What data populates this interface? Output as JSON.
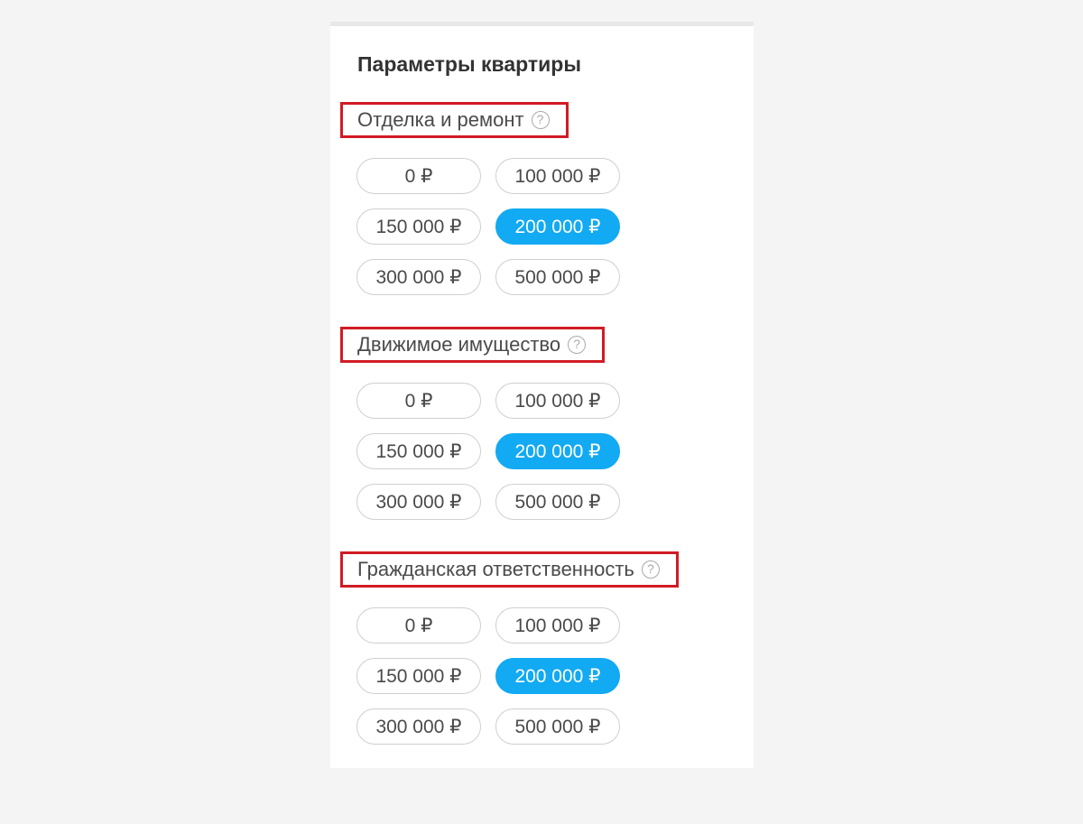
{
  "panel": {
    "title": "Параметры квартиры"
  },
  "sections": [
    {
      "label": "Отделка и ремонт",
      "help_glyph": "?",
      "options": [
        "0 ₽",
        "100 000 ₽",
        "150 000 ₽",
        "200 000 ₽",
        "300 000 ₽",
        "500 000 ₽"
      ],
      "selected_value": "200 000 ₽"
    },
    {
      "label": "Движимое имущество",
      "help_glyph": "?",
      "options": [
        "0 ₽",
        "100 000 ₽",
        "150 000 ₽",
        "200 000 ₽",
        "300 000 ₽",
        "500 000 ₽"
      ],
      "selected_value": "200 000 ₽"
    },
    {
      "label": "Гражданская ответственность",
      "help_glyph": "?",
      "options": [
        "0 ₽",
        "100 000 ₽",
        "150 000 ₽",
        "200 000 ₽",
        "300 000 ₽",
        "500 000 ₽"
      ],
      "selected_value": "200 000 ₽"
    }
  ],
  "colors": {
    "selected_bg": "#12aaf2",
    "highlight_border": "#d11b24",
    "page_bg": "#f4f4f4"
  },
  "icons": {
    "help": "question-circle-icon"
  }
}
